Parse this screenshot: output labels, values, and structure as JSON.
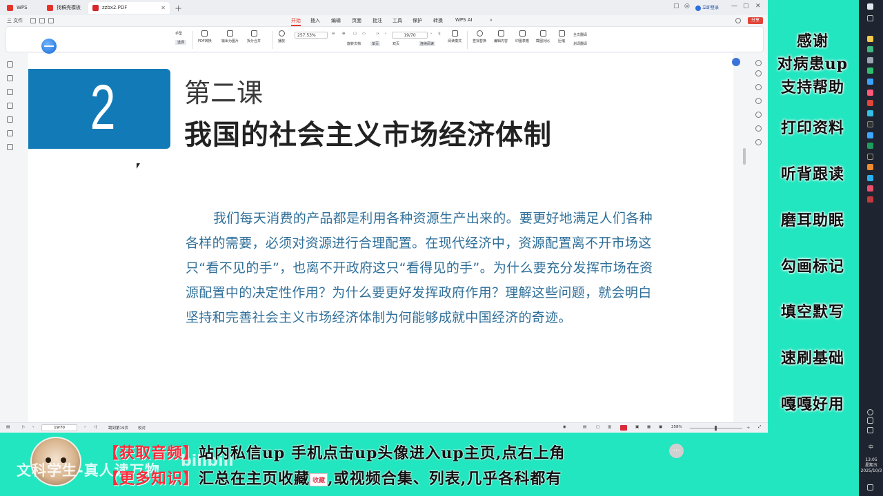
{
  "window": {
    "tabs": [
      {
        "label": "WPS Office",
        "color": "#e5332a"
      },
      {
        "label": "找稿壳模板",
        "color": "#e5332a"
      },
      {
        "label": "zzbx2.PDF",
        "color": "#d7262e"
      }
    ],
    "login_label": "立即登录"
  },
  "menubar": {
    "file": "三 文件",
    "items": [
      "开始",
      "插入",
      "编辑",
      "页面",
      "批注",
      "工具",
      "保护",
      "转换",
      "WPS AI"
    ],
    "active": "开始",
    "share_label": "分享"
  },
  "ribbon": {
    "hand_tool": "手型",
    "select_tool": "选择",
    "pdf_convert": "PDF转换",
    "export_image": "输出为图片",
    "split_merge": "拆分合并",
    "play": "播放",
    "zoom": "257.53%",
    "page": "19/70",
    "rotate": "旋转文档",
    "single_page": "单页",
    "double_page": "双页",
    "continuous": "连续阅读",
    "read_mode": "阅读模式",
    "find_replace": "查找替换",
    "edit_content": "编辑内容",
    "print_table": "印图表格",
    "screenshot_compare": "截图对比",
    "compress": "压缩",
    "full_translate": "全文翻译",
    "word_translate": "划词翻译"
  },
  "document": {
    "lesson_number": "2",
    "lesson_label": "第二课",
    "lesson_title": "我国的社会主义市场经济体制",
    "body": "我们每天消费的产品都是利用各种资源生产出来的。要更好地满足人们各种各样的需要，必须对资源进行合理配置。在现代经济中，资源配置离不开市场这只“看不见的手”，也离不开政府这只“看得见的手”。为什么要充分发挥市场在资源配置中的决定性作用？为什么要更好发挥政府作用？理解这些问题，就会明白坚持和完善社会主义市场经济体制为何能够成就中国经济的奇迹。",
    "accent_color": "#127bb7",
    "body_color": "#2f6f99"
  },
  "statusbar": {
    "page": "19/70",
    "goto": "跳到第19页",
    "proofread": "校对",
    "zoom": "258%"
  },
  "side_overlay": {
    "lines": [
      "感谢",
      "对病患up",
      "支持帮助",
      "打印资料",
      "听背跟读",
      "磨耳助眠",
      "勾画标记",
      "填空默写",
      "速刷基础",
      "嘎嘎好用"
    ]
  },
  "banner": {
    "line1_bracket": "【获取音频】",
    "line1_text": "站内私信up 手机点击up头像进入up主页,点右上角",
    "line2_bracket": "【更多知识】",
    "line2_text_a": "汇总在主页收藏",
    "fav_badge": "收藏",
    "line2_text_b": ",或视频合集、列表,几乎各科都有",
    "watermark": "文科学生-真人读万物",
    "watermark_logo": "bilibili"
  },
  "taskbar": {
    "ime": "中",
    "time": "13:05",
    "weekday": "星期五",
    "date": "2025/10/3"
  }
}
